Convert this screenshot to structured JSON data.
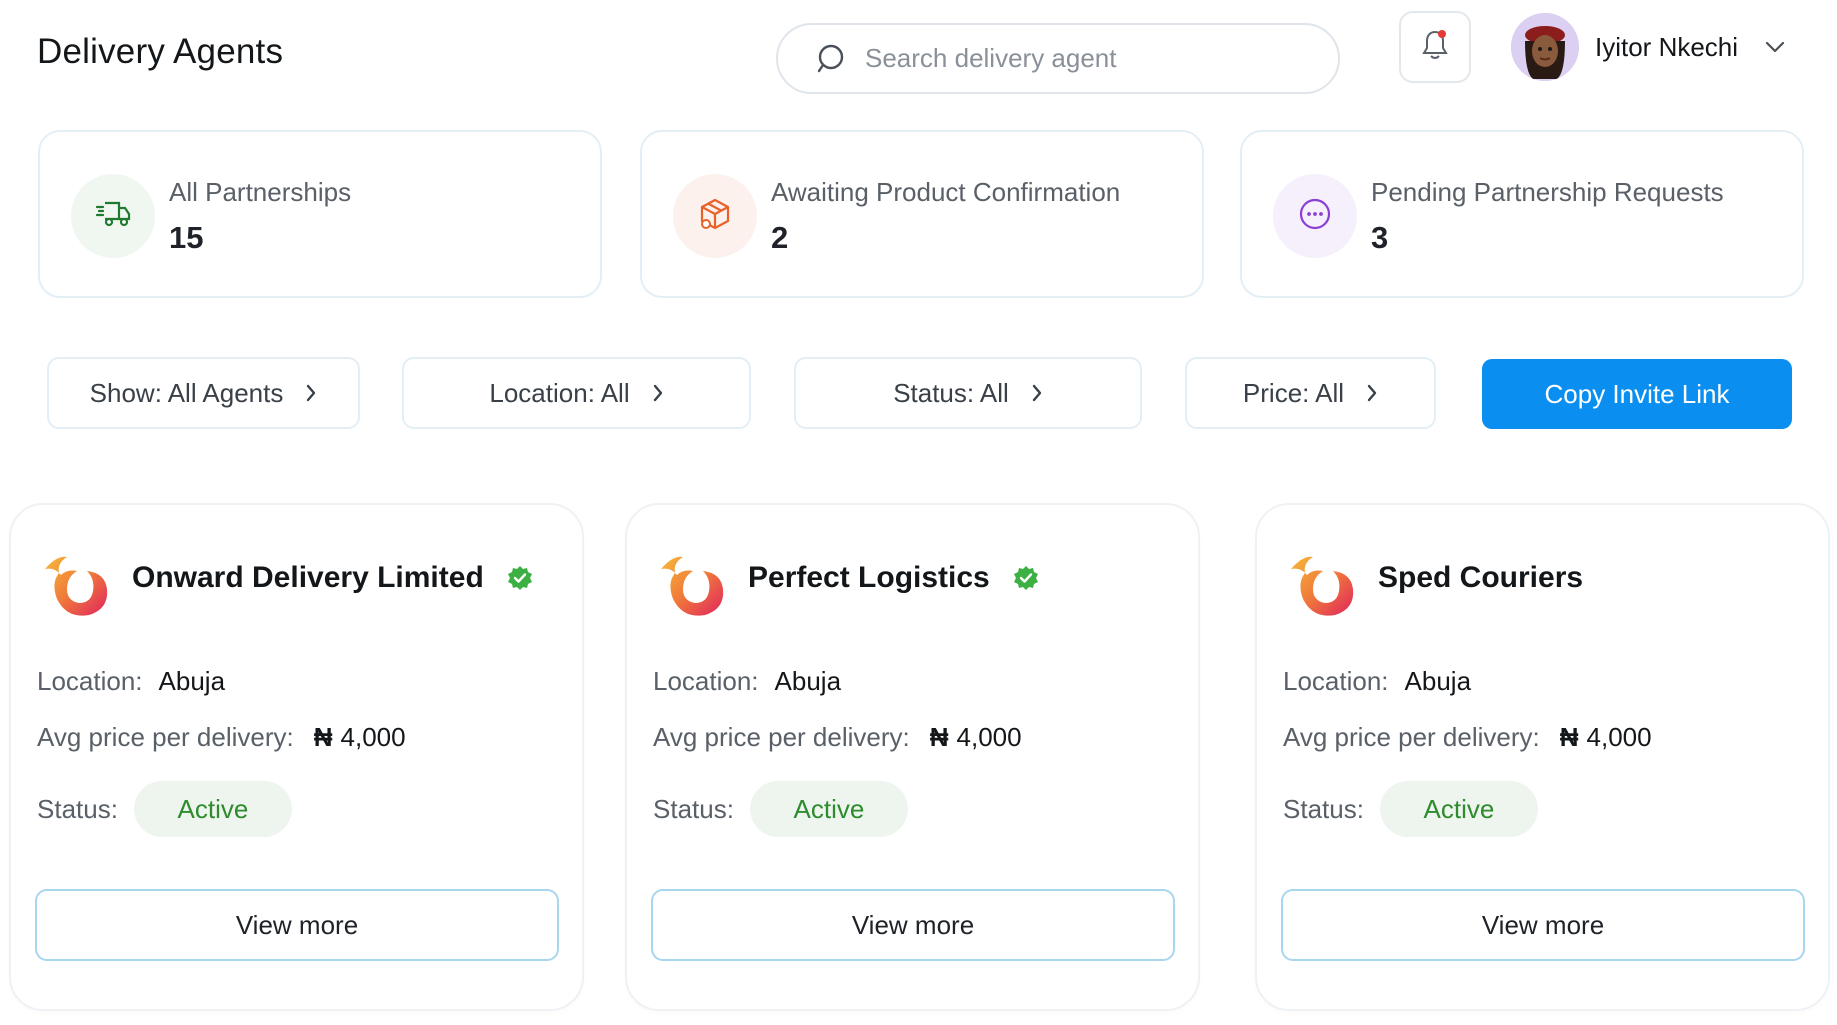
{
  "header": {
    "title": "Delivery Agents",
    "search_placeholder": "Search delivery agent",
    "user_name": "Iyitor Nkechi"
  },
  "stats": [
    {
      "label": "All Partnerships",
      "value": "15",
      "icon": "delivery-truck-icon",
      "color": "#1e7a2e",
      "bg": "#f0f6f0"
    },
    {
      "label": "Awaiting Product Confirmation",
      "value": "2",
      "icon": "package-icon",
      "color": "#e8622a",
      "bg": "#fcf1ed"
    },
    {
      "label": "Pending Partnership Requests",
      "value": "3",
      "icon": "more-dots-icon",
      "color": "#8a3fd6",
      "bg": "#f5f0fb"
    }
  ],
  "filters": {
    "show": "Show: All Agents",
    "location": "Location: All",
    "status": "Status: All",
    "price": "Price: All",
    "invite_button": "Copy Invite Link"
  },
  "labels": {
    "location": "Location:",
    "avg_price": "Avg price per delivery:",
    "status": "Status:",
    "currency": "₦",
    "view_more": "View more"
  },
  "agents": [
    {
      "name": "Onward Delivery Limited",
      "verified": true,
      "location": "Abuja",
      "price": "4,000",
      "status": "Active"
    },
    {
      "name": "Perfect Logistics",
      "verified": true,
      "location": "Abuja",
      "price": "4,000",
      "status": "Active"
    },
    {
      "name": "Sped Couriers",
      "verified": false,
      "location": "Abuja",
      "price": "4,000",
      "status": "Active"
    }
  ],
  "colors": {
    "primary": "#0a8ff0",
    "active_text": "#2e8b2e",
    "active_bg": "#eef4ee",
    "verified": "#3cb043"
  }
}
